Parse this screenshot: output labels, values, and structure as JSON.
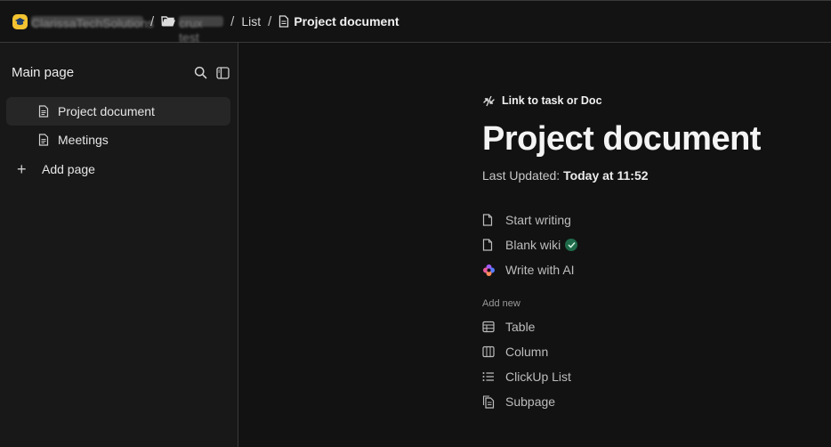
{
  "topbar": {
    "workspace_name": "ClarissaTechSolutions",
    "space_name": "crux test",
    "list_label": "List",
    "current_page": "Project document",
    "separator": "/"
  },
  "sidebar": {
    "title": "Main page",
    "items": [
      {
        "label": "Project document",
        "icon": "document-icon",
        "active": true
      },
      {
        "label": "Meetings",
        "icon": "document-icon",
        "active": false
      }
    ],
    "add_page_label": "Add page"
  },
  "main": {
    "link_label": "Link to task or Doc",
    "title": "Project document",
    "updated_prefix": "Last Updated:",
    "updated_value": "Today at 11:52",
    "options": [
      {
        "label": "Start writing",
        "icon": "page-icon"
      },
      {
        "label": "Blank wiki",
        "icon": "page-icon",
        "badge": "verified-check-icon"
      },
      {
        "label": "Write with AI",
        "icon": "ai-sparkle-icon"
      }
    ],
    "add_new_label": "Add new",
    "add_new_items": [
      {
        "label": "Table",
        "icon": "table-icon"
      },
      {
        "label": "Column",
        "icon": "column-icon"
      },
      {
        "label": "ClickUp List",
        "icon": "list-icon"
      },
      {
        "label": "Subpage",
        "icon": "subpage-icon"
      }
    ]
  },
  "colors": {
    "background": "#121212",
    "sidebar_bg": "#181818",
    "active_item_bg": "#262626",
    "workspace_logo": "#f2c230",
    "check_badge": "#1f6b4a",
    "ai_icon": "#9b6bff"
  }
}
